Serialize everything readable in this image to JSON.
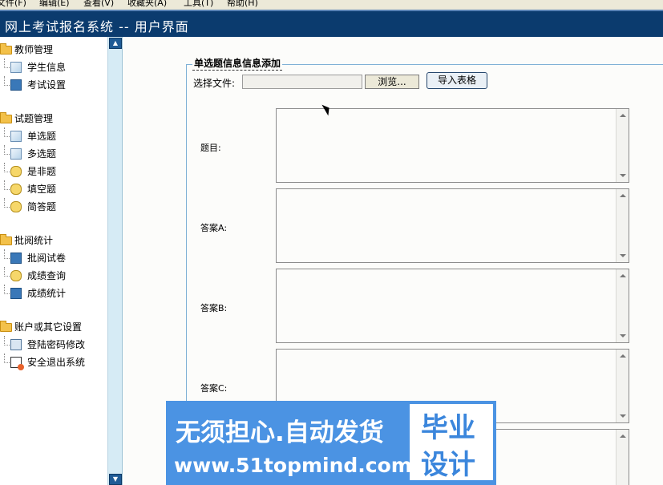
{
  "menubar": {
    "items": [
      "文件(F)",
      "编辑(E)",
      "查看(V)",
      "收藏夹(A)",
      "工具(T)",
      "帮助(H)"
    ]
  },
  "app": {
    "title": "网上考试报名系统 -- 用户界面"
  },
  "sidebar": {
    "groups": [
      {
        "title": "教师管理",
        "items": [
          "学生信息",
          "考试设置"
        ]
      },
      {
        "title": "试题管理",
        "items": [
          "单选题",
          "多选题",
          "是非题",
          "填空题",
          "简答题"
        ]
      },
      {
        "title": "批阅统计",
        "items": [
          "批阅试卷",
          "成绩查询",
          "成绩统计"
        ]
      },
      {
        "title": "账户或其它设置",
        "items": [
          "登陆密码修改",
          "安全退出系统"
        ]
      }
    ],
    "scroll_up": "▲",
    "scroll_down": "▼"
  },
  "form": {
    "legend": "单选题信息信息添加",
    "file_label": "选择文件:",
    "file_value": "",
    "browse_label": "浏览...",
    "import_label": "导入表格",
    "fields": [
      {
        "label": "题目:",
        "value": ""
      },
      {
        "label": "答案A:",
        "value": ""
      },
      {
        "label": "答案B:",
        "value": ""
      },
      {
        "label": "答案C:",
        "value": ""
      },
      {
        "label": "",
        "value": ""
      }
    ]
  },
  "watermark": {
    "line1": "无须担心.自动发货",
    "line2": "www.51topmind.com",
    "box_top": "毕业",
    "box_bottom": "设计"
  }
}
